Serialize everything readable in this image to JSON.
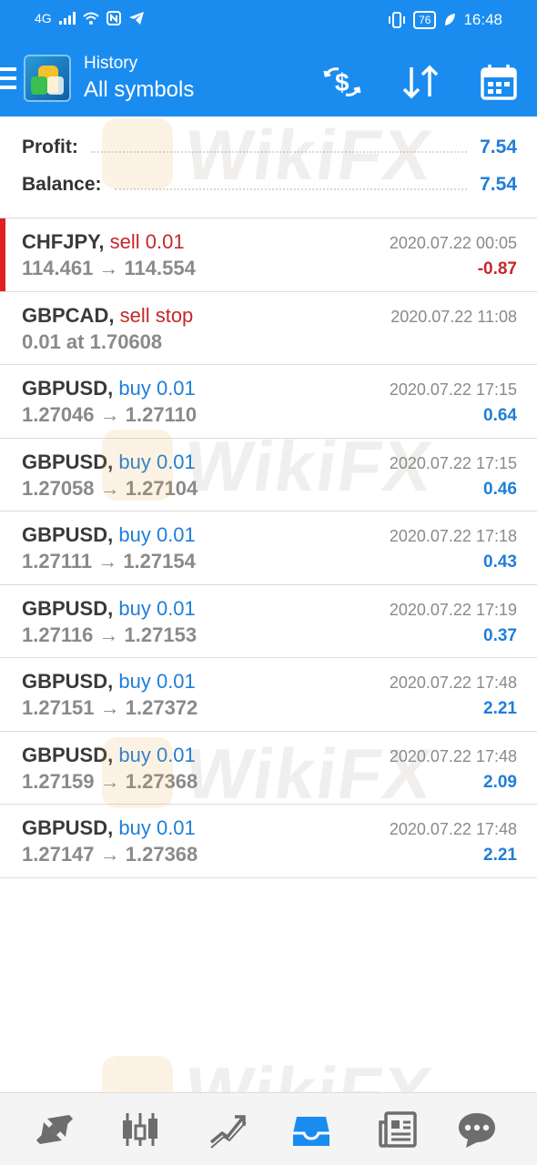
{
  "status_bar": {
    "network": "4G",
    "battery": "76",
    "time": "16:48"
  },
  "header": {
    "subtitle": "History",
    "title": "All symbols"
  },
  "summary": {
    "profit_label": "Profit:",
    "profit_value": "7.54",
    "balance_label": "Balance:",
    "balance_value": "7.54"
  },
  "trades": [
    {
      "symbol": "CHFJPY,",
      "action": "sell 0.01",
      "detail": "114.461 → 114.554",
      "date": "2020.07.22 00:05",
      "profit": "-0.87"
    },
    {
      "symbol": "GBPCAD,",
      "action": "sell stop",
      "detail": "0.01 at 1.70608",
      "date": "2020.07.22 11:08",
      "profit": ""
    },
    {
      "symbol": "GBPUSD,",
      "action": "buy 0.01",
      "detail": "1.27046 → 1.27110",
      "date": "2020.07.22 17:15",
      "profit": "0.64"
    },
    {
      "symbol": "GBPUSD,",
      "action": "buy 0.01",
      "detail": "1.27058 → 1.27104",
      "date": "2020.07.22 17:15",
      "profit": "0.46"
    },
    {
      "symbol": "GBPUSD,",
      "action": "buy 0.01",
      "detail": "1.27111 → 1.27154",
      "date": "2020.07.22 17:18",
      "profit": "0.43"
    },
    {
      "symbol": "GBPUSD,",
      "action": "buy 0.01",
      "detail": "1.27116 → 1.27153",
      "date": "2020.07.22 17:19",
      "profit": "0.37"
    },
    {
      "symbol": "GBPUSD,",
      "action": "buy 0.01",
      "detail": "1.27151 → 1.27372",
      "date": "2020.07.22 17:48",
      "profit": "2.21"
    },
    {
      "symbol": "GBPUSD,",
      "action": "buy 0.01",
      "detail": "1.27159 → 1.27368",
      "date": "2020.07.22 17:48",
      "profit": "2.09"
    },
    {
      "symbol": "GBPUSD,",
      "action": "buy 0.01",
      "detail": "1.27147 → 1.27368",
      "date": "2020.07.22 17:48",
      "profit": "2.21"
    }
  ],
  "watermark": "WikiFX",
  "colors": {
    "header": "#1a8cf0",
    "sell": "#c62828",
    "buy": "#1f7ed8",
    "active_nav": "#1a8cf0"
  },
  "icons": {
    "header": [
      "menu-icon",
      "currency-exchange-icon",
      "sort-icon",
      "calendar-icon"
    ],
    "nav": [
      "trade-icon",
      "candlestick-chart-icon",
      "trend-chart-icon",
      "history-inbox-icon",
      "news-icon",
      "chat-icon"
    ]
  }
}
